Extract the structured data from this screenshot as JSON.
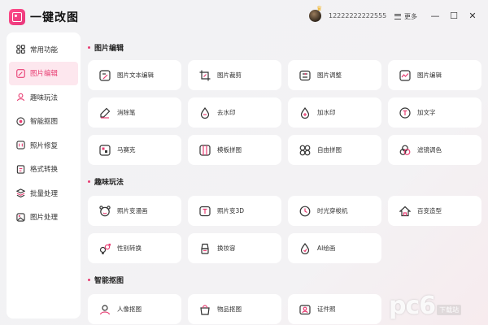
{
  "app": {
    "title": "一键改图"
  },
  "titlebar": {
    "username": "12222222222555",
    "more_label": "更多",
    "minimize": "—",
    "maximize": "☐",
    "close": "✕"
  },
  "sidebar": {
    "items": [
      {
        "label": "常用功能",
        "icon": "grid-icon"
      },
      {
        "label": "图片编辑",
        "icon": "image-edit-icon",
        "active": true
      },
      {
        "label": "趣味玩法",
        "icon": "fun-icon"
      },
      {
        "label": "智能抠图",
        "icon": "cutout-icon"
      },
      {
        "label": "照片修复",
        "icon": "repair-icon"
      },
      {
        "label": "格式转换",
        "icon": "convert-icon"
      },
      {
        "label": "批量处理",
        "icon": "batch-icon"
      },
      {
        "label": "图片处理",
        "icon": "process-icon"
      }
    ]
  },
  "sections": [
    {
      "title": "图片编辑",
      "cards": [
        {
          "label": "图片文本编辑",
          "icon": "text-edit-icon"
        },
        {
          "label": "图片裁剪",
          "icon": "crop-icon"
        },
        {
          "label": "图片调整",
          "icon": "adjust-icon"
        },
        {
          "label": "图片编辑",
          "icon": "image-edit-icon"
        },
        {
          "label": "消除笔",
          "icon": "eraser-pen-icon"
        },
        {
          "label": "去水印",
          "icon": "remove-watermark-icon"
        },
        {
          "label": "加水印",
          "icon": "add-watermark-icon"
        },
        {
          "label": "加文字",
          "icon": "add-text-icon"
        },
        {
          "label": "马赛克",
          "icon": "mosaic-icon"
        },
        {
          "label": "模板拼图",
          "icon": "template-collage-icon"
        },
        {
          "label": "自由拼图",
          "icon": "free-collage-icon"
        },
        {
          "label": "滤镜调色",
          "icon": "filter-icon"
        }
      ]
    },
    {
      "title": "趣味玩法",
      "cards": [
        {
          "label": "照片变漫画",
          "icon": "cartoon-icon"
        },
        {
          "label": "照片变3D",
          "icon": "3d-icon"
        },
        {
          "label": "时光穿梭机",
          "icon": "time-machine-icon"
        },
        {
          "label": "百变造型",
          "icon": "style-icon"
        },
        {
          "label": "性别转换",
          "icon": "gender-icon"
        },
        {
          "label": "换妆容",
          "icon": "makeup-icon"
        },
        {
          "label": "AI绘画",
          "icon": "ai-paint-icon"
        }
      ]
    },
    {
      "title": "智能抠图",
      "cards": [
        {
          "label": "人像抠图",
          "icon": "portrait-cutout-icon"
        },
        {
          "label": "物品抠图",
          "icon": "object-cutout-icon"
        },
        {
          "label": "证件照",
          "icon": "id-photo-icon"
        }
      ]
    }
  ],
  "watermark": {
    "logo": "pc6",
    "sub": "下载站"
  },
  "colors": {
    "accent": "#e83e73",
    "active_bg": "#fde7ee"
  }
}
